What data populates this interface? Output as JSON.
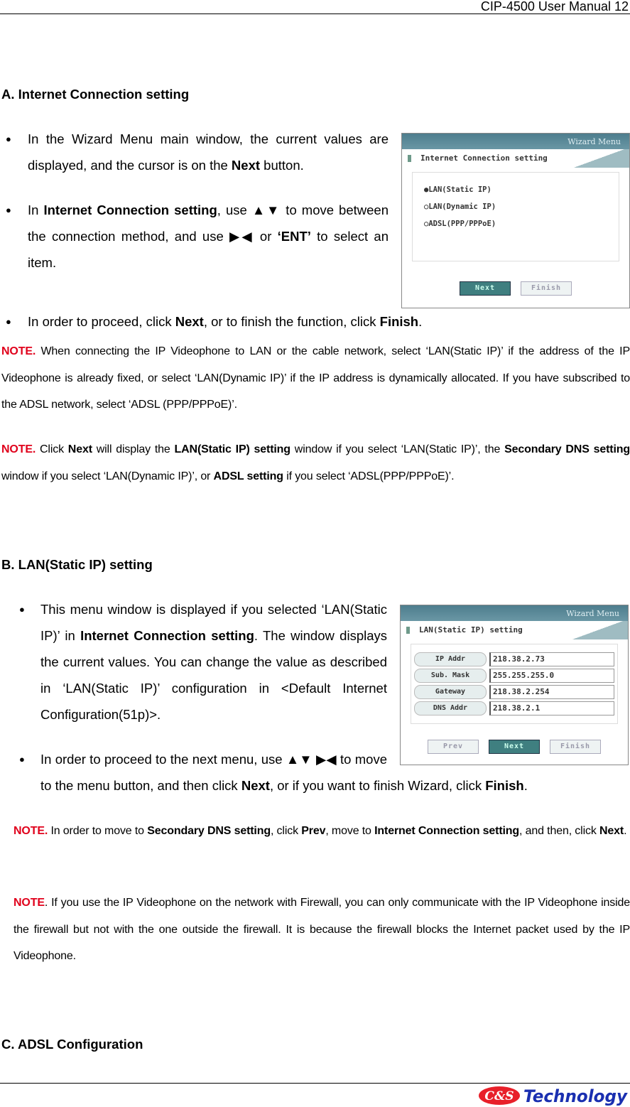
{
  "header": {
    "title": "CIP-4500 User Manual 12"
  },
  "section_a": {
    "heading": "A. Internet Connection setting",
    "bullets": [
      [
        {
          "t": "In the Wizard Menu main window, the current values are displayed, and the cursor is on the "
        },
        {
          "t": "Next",
          "b": true
        },
        {
          "t": " button."
        }
      ],
      [
        {
          "t": "In "
        },
        {
          "t": "Internet Connection setting",
          "b": true
        },
        {
          "t": ", use ▲▼ to move between the connection method, and use ▶◀ or "
        },
        {
          "t": "‘ENT’",
          "b": true
        },
        {
          "t": " to select an item."
        }
      ],
      [
        {
          "t": "In order to proceed, click "
        },
        {
          "t": "Next",
          "b": true
        },
        {
          "t": ", or to finish the function, click "
        },
        {
          "t": "Finish",
          "b": true
        },
        {
          "t": "."
        }
      ]
    ],
    "notes": [
      [
        {
          "t": "NOTE.",
          "r": true
        },
        {
          "t": " When connecting the IP Videophone to LAN or the cable network, select ‘LAN(Static IP)’ if the address of the IP Videophone is already fixed, or select ‘LAN(Dynamic IP)’ if the IP address is dynamically allocated. If you have subscribed to the ADSL network, select ‘ADSL (PPP/PPPoE)’."
        }
      ],
      [
        {
          "t": "NOTE.",
          "r": true
        },
        {
          "t": " Click "
        },
        {
          "t": "Next",
          "b": true
        },
        {
          "t": " will display the "
        },
        {
          "t": "LAN(Static IP) setting",
          "b": true
        },
        {
          "t": " window if you select ‘LAN(Static IP)’, the "
        },
        {
          "t": "Secondary DNS setting",
          "b": true
        },
        {
          "t": " window if you select ‘LAN(Dynamic IP)’, or "
        },
        {
          "t": "ADSL setting",
          "b": true
        },
        {
          "t": " if you select ‘ADSL(PPP/PPPoE)’."
        }
      ]
    ],
    "screen": {
      "window_title": "Wizard Menu",
      "subtitle": "Internet Connection setting",
      "options": [
        "●LAN(Static IP)",
        "○LAN(Dynamic IP)",
        "○ADSL(PPP/PPPoE)"
      ],
      "buttons": [
        "Next",
        "Finish"
      ]
    }
  },
  "section_b": {
    "heading": "B. LAN(Static IP) setting",
    "bullets": [
      [
        {
          "t": "This menu window is displayed if you selected ‘LAN(Static IP)’ in "
        },
        {
          "t": "Internet Connection setting",
          "b": true
        },
        {
          "t": ". The window displays the current values. You can change the value as described in ‘LAN(Static IP)’ configuration in <Default Internet Configuration(51p)>."
        }
      ],
      [
        {
          "t": "In order to proceed to the next menu, use ▲▼ ▶◀ to move to the menu button, and then click "
        },
        {
          "t": "Next",
          "b": true
        },
        {
          "t": ", or if you want to finish Wizard, click "
        },
        {
          "t": "Finish",
          "b": true
        },
        {
          "t": "."
        }
      ]
    ],
    "notes": [
      [
        {
          "t": "NOTE.",
          "r": true
        },
        {
          "t": " In order to move to "
        },
        {
          "t": "Secondary DNS setting",
          "b": true
        },
        {
          "t": ", click "
        },
        {
          "t": "Prev",
          "b": true
        },
        {
          "t": ", move to "
        },
        {
          "t": "Internet Connection setting",
          "b": true
        },
        {
          "t": ", and then, click "
        },
        {
          "t": "Next",
          "b": true
        },
        {
          "t": "."
        }
      ],
      [
        {
          "t": "NOTE",
          "r": true
        },
        {
          "t": ". If you use the IP Videophone on the network with Firewall, you can only communicate with the IP Videophone inside the firewall but not with the one outside the firewall. It is because the firewall blocks the Internet packet used by the IP Videophone."
        }
      ]
    ],
    "screen": {
      "window_title": "Wizard Menu",
      "subtitle": "LAN(Static IP) setting",
      "fields": [
        {
          "label": "IP Addr",
          "value": "218.38.2.73"
        },
        {
          "label": "Sub. Mask",
          "value": "255.255.255.0"
        },
        {
          "label": "Gateway",
          "value": "218.38.2.254"
        },
        {
          "label": "DNS Addr",
          "value": "218.38.2.1"
        }
      ],
      "buttons": [
        "Prev",
        "Next",
        "Finish"
      ]
    }
  },
  "section_c": {
    "heading": "C. ADSL Configuration"
  },
  "footer": {
    "logo_text": "C&S Technology"
  }
}
